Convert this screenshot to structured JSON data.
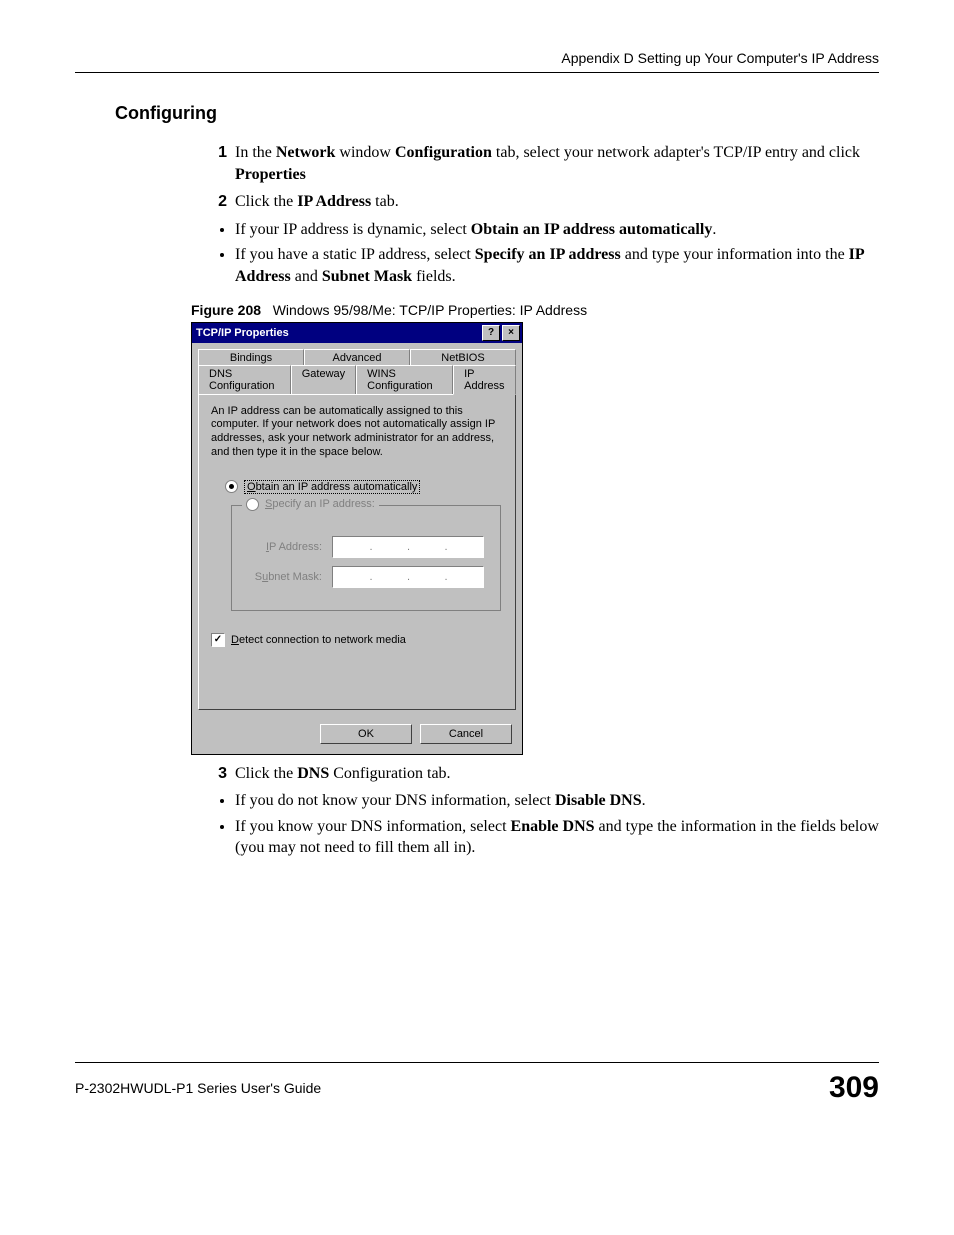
{
  "header": {
    "appendix_line": "Appendix D Setting up Your Computer's IP Address"
  },
  "section": {
    "heading": "Configuring"
  },
  "steps": {
    "n1": "1",
    "s1_a": "In the ",
    "s1_b": "Network",
    "s1_c": " window ",
    "s1_d": "Configuration",
    "s1_e": " tab, select your network adapter's TCP/IP entry and click ",
    "s1_f": "Properties",
    "n2": "2",
    "s2_a": "Click the ",
    "s2_b": "IP Address",
    "s2_c": " tab.",
    "b2_1a": "If your IP address is dynamic, select ",
    "b2_1b": "Obtain an IP address automatically",
    "b2_1c": ".",
    "b2_2a": "If you have a static IP address, select ",
    "b2_2b": "Specify an IP address",
    "b2_2c": " and type your information into the ",
    "b2_2d": "IP Address",
    "b2_2e": " and ",
    "b2_2f": "Subnet Mask",
    "b2_2g": " fields.",
    "n3": "3",
    "s3_a": "Click the ",
    "s3_b": "DNS",
    "s3_c": " Configuration tab.",
    "b3_1a": "If you do not know your DNS information, select ",
    "b3_1b": "Disable DNS",
    "b3_1c": ".",
    "b3_2a": "If you know your DNS information, select ",
    "b3_2b": "Enable DNS",
    "b3_2c": " and type the information in the fields below (you may not need to fill them all in)."
  },
  "figure": {
    "label": "Figure 208",
    "caption": "Windows 95/98/Me: TCP/IP Properties: IP Address"
  },
  "dialog": {
    "title": "TCP/IP Properties",
    "help_btn": "?",
    "close_btn": "×",
    "tabs_row1": {
      "t1": "Bindings",
      "t2": "Advanced",
      "t3": "NetBIOS"
    },
    "tabs_row2": {
      "t1": "DNS Configuration",
      "t2": "Gateway",
      "t3": "WINS Configuration",
      "t4": "IP Address"
    },
    "description": "An IP address can be automatically assigned to this computer. If your network does not automatically assign IP addresses, ask your network administrator for an address, and then type it in the space below.",
    "radio_obtain_pre": "O",
    "radio_obtain": "btain an IP address automatically",
    "radio_specify_pre": "S",
    "radio_specify": "pecify an IP address:",
    "lbl_ip_pre": "I",
    "lbl_ip": "P Address:",
    "lbl_subnet_pre": "u",
    "lbl_subnet_a": "S",
    "lbl_subnet_b": "bnet Mask:",
    "checkbox_mark": "✓",
    "checkbox_pre": "D",
    "checkbox_label": "etect connection to network media",
    "ok": "OK",
    "cancel": "Cancel"
  },
  "footer": {
    "guide": "P-2302HWUDL-P1 Series User's Guide",
    "page": "309"
  }
}
